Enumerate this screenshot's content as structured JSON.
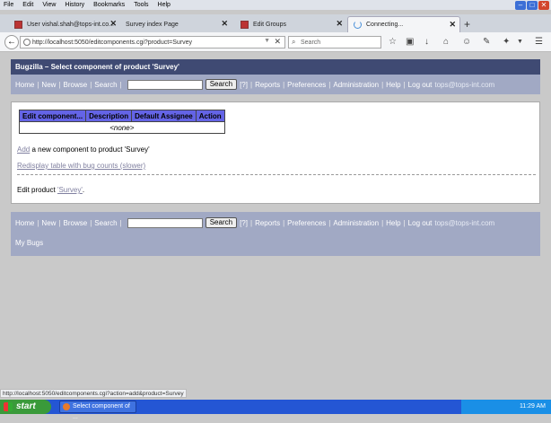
{
  "menubar": [
    "File",
    "Edit",
    "View",
    "History",
    "Bookmarks",
    "Tools",
    "Help"
  ],
  "tabs": [
    {
      "label": "User vishal.shah@tops-int.co..."
    },
    {
      "label": "Survey index Page"
    },
    {
      "label": "Edit Groups"
    },
    {
      "label": "Connecting..."
    }
  ],
  "url": "http://localhost:5050/editcomponents.cgi?product=Survey",
  "search_placeholder": "Search",
  "page": {
    "header": "Bugzilla – Select component of product 'Survey'",
    "nav": [
      "Home",
      "New",
      "Browse",
      "Search"
    ],
    "search_button": "Search",
    "help_link": "[?]",
    "nav_right": [
      "Reports",
      "Preferences",
      "Administration",
      "Help",
      "Log out"
    ],
    "user_email": "tops@tops-int.com",
    "table": {
      "headers": [
        "Edit component...",
        "Description",
        "Default Assignee",
        "Action"
      ],
      "empty": "<none>"
    },
    "add_link": "Add",
    "add_text": "a new component to product 'Survey'",
    "redisplay": "Redisplay table with bug counts (slower)",
    "edit_prefix": "Edit product",
    "edit_link": "'Survey'",
    "edit_suffix": ".",
    "my_bugs": "My Bugs"
  },
  "status_url": "http://localhost:5050/editcomponents.cgi?action=add&product=Survey",
  "taskbar": {
    "start": "start",
    "item": "Select component of ...",
    "clock": "11:29 AM"
  }
}
